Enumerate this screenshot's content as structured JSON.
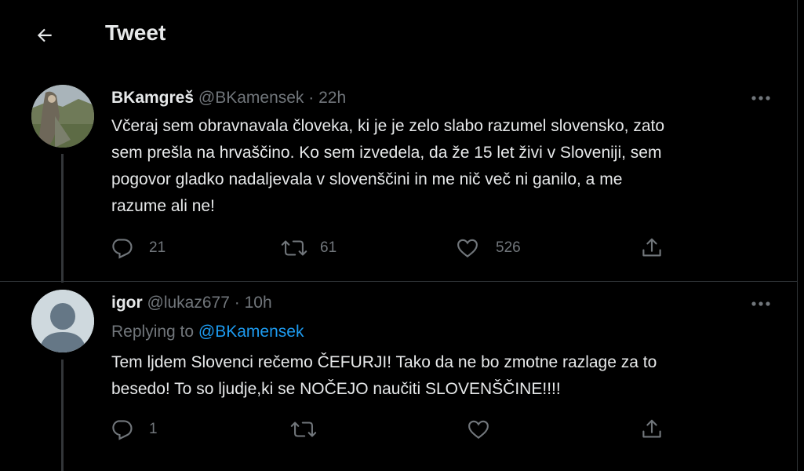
{
  "header": {
    "back_icon": "arrow-left-icon",
    "title": "Tweet"
  },
  "tweets": [
    {
      "name": "BKamgreš",
      "handle": "@BKamensek",
      "dot": "·",
      "time": "22h",
      "lines": [
        "Včeraj sem obravnavala človeka, ki je je zelo slabo razumel slovensko, zato",
        "sem prešla na hrvaščino. Ko sem izvedela, da že 15 let živi v Sloveniji, sem",
        "pogovor gladko nadaljevala v slovenščini in me nič več ni ganilo, a me",
        "razume ali ne!"
      ],
      "replies": "21",
      "retweets": "61",
      "likes": "526"
    },
    {
      "name": "igor",
      "handle": "@lukaz677",
      "dot": "·",
      "time": "10h",
      "replying_prefix": "Replying to",
      "replying_handle": "@BKamensek",
      "lines": [
        "Tem ljdem Slovenci rečemo ČEFURJI! Tako da ne bo zmotne razlage za to",
        "besedo! To so ljudje,ki se NOČEJO naučiti SLOVENŠČINE!!!!"
      ],
      "replies": "1",
      "retweets": "",
      "likes": ""
    }
  ],
  "icons": {
    "reply": "reply-icon",
    "retweet": "retweet-icon",
    "like": "heart-icon",
    "share": "share-icon",
    "more": "more-icon"
  },
  "colors": {
    "background": "#000000",
    "text": "#e7e9ea",
    "muted": "#71767b",
    "link": "#1d9bf0"
  }
}
